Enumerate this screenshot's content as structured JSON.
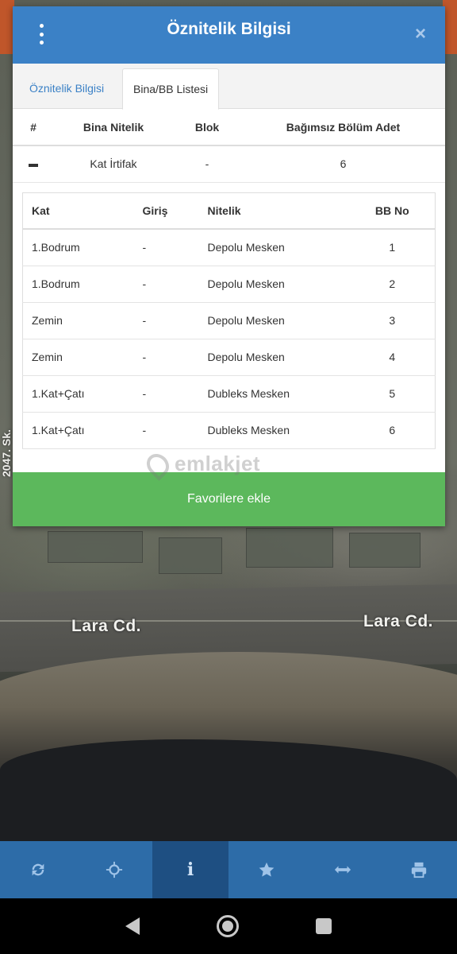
{
  "map": {
    "labels": {
      "road_left": "Lara Cd.",
      "road_right": "Lara Cd.",
      "street_vertical": "2047. Sk."
    }
  },
  "modal": {
    "title": "Öznitelik Bilgisi",
    "close_symbol": "×",
    "tabs": [
      {
        "label": "Öznitelik Bilgisi",
        "active": false
      },
      {
        "label": "Bina/BB Listesi",
        "active": true
      }
    ],
    "bina_table": {
      "headers": [
        "#",
        "Bina Nitelik",
        "Blok",
        "Bağımsız Bölüm Adet"
      ],
      "row": {
        "toggle_icon": "minus-icon",
        "nitelik": "Kat İrtifak",
        "blok": "-",
        "adet": "6"
      }
    },
    "bb_table": {
      "headers": [
        "Kat",
        "Giriş",
        "Nitelik",
        "BB No"
      ],
      "rows": [
        {
          "kat": "1.Bodrum",
          "giris": "-",
          "nitelik": "Depolu Mesken",
          "no": "1"
        },
        {
          "kat": "1.Bodrum",
          "giris": "-",
          "nitelik": "Depolu Mesken",
          "no": "2"
        },
        {
          "kat": "Zemin",
          "giris": "-",
          "nitelik": "Depolu Mesken",
          "no": "3"
        },
        {
          "kat": "Zemin",
          "giris": "-",
          "nitelik": "Depolu Mesken",
          "no": "4"
        },
        {
          "kat": "1.Kat+Çatı",
          "giris": "-",
          "nitelik": "Dubleks Mesken",
          "no": "5"
        },
        {
          "kat": "1.Kat+Çatı",
          "giris": "-",
          "nitelik": "Dubleks Mesken",
          "no": "6"
        }
      ]
    },
    "favorite_button": "Favorilere ekle",
    "watermark": "emlakjet"
  },
  "toolbar": {
    "items": [
      {
        "icon": "refresh-icon",
        "active": false
      },
      {
        "icon": "crosshair-icon",
        "active": false
      },
      {
        "icon": "info-icon",
        "active": true
      },
      {
        "icon": "star-icon",
        "active": false
      },
      {
        "icon": "measure-arrows-icon",
        "active": false
      },
      {
        "icon": "print-icon",
        "active": false
      }
    ],
    "info_glyph": "i"
  },
  "colors": {
    "header_blue": "#3b81c6",
    "toolbar_blue": "#2d6ca8",
    "toolbar_active": "#1e4f82",
    "favorite_green": "#5cb85c"
  }
}
